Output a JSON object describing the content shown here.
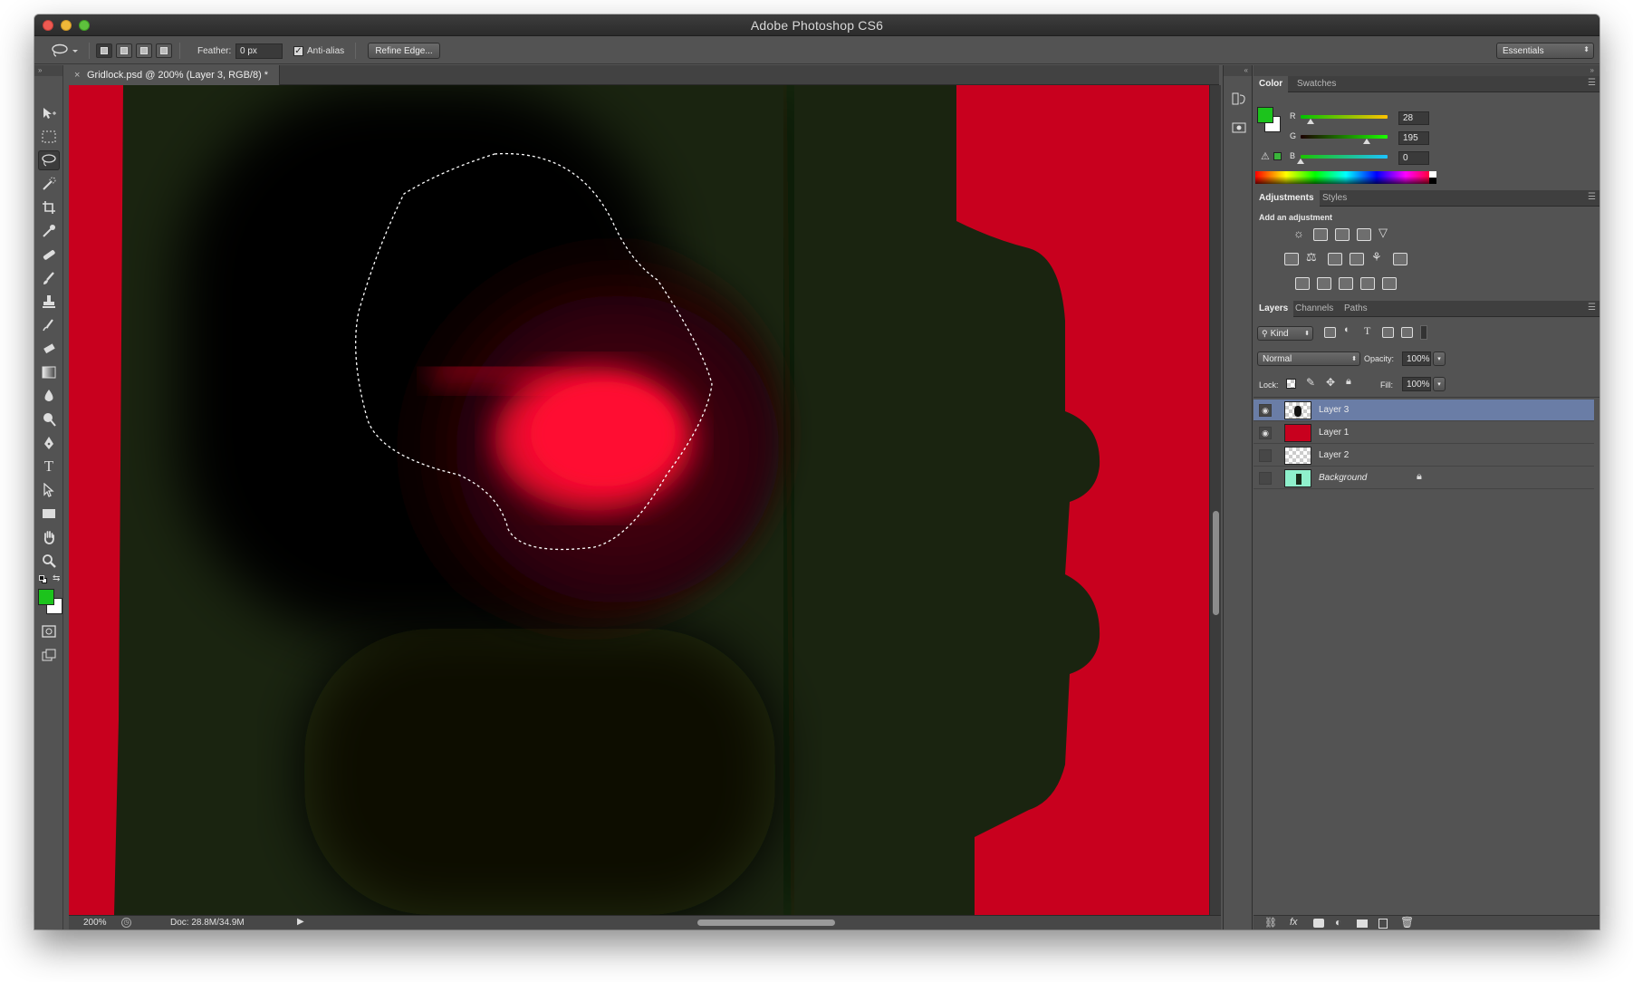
{
  "window": {
    "title": "Adobe Photoshop CS6"
  },
  "options_bar": {
    "feather_label": "Feather:",
    "feather_value": "0 px",
    "antialias_label": "Anti-alias",
    "antialias_checked": true,
    "refine_edge": "Refine Edge...",
    "workspace": "Essentials"
  },
  "document": {
    "tab_title": "Gridlock.psd @ 200% (Layer 3, RGB/8) *",
    "close_glyph": "×"
  },
  "status": {
    "zoom": "200%",
    "doc_size": "Doc: 28.8M/34.9M"
  },
  "tools": [
    "move-tool",
    "rectangular-marquee-tool",
    "lasso-tool",
    "quick-selection-tool",
    "crop-tool",
    "eyedropper-tool",
    "spot-healing-brush-tool",
    "brush-tool",
    "clone-stamp-tool",
    "history-brush-tool",
    "eraser-tool",
    "gradient-tool",
    "blur-tool",
    "dodge-tool",
    "pen-tool",
    "type-tool",
    "path-selection-tool",
    "rectangle-tool",
    "hand-tool",
    "zoom-tool"
  ],
  "colors": {
    "foreground": "#1cc31c",
    "background": "#ffffff",
    "canvas_red": "#c8001e",
    "glow_red": "#ff0a33",
    "dark_green": "#1a2410"
  },
  "color_panel": {
    "tabs": [
      "Color",
      "Swatches"
    ],
    "r_label": "R",
    "g_label": "G",
    "b_label": "B",
    "r": "28",
    "g": "195",
    "b": "0",
    "r_value": 28,
    "g_value": 195,
    "b_value": 0
  },
  "adjustments_panel": {
    "tabs": [
      "Adjustments",
      "Styles"
    ],
    "heading": "Add an adjustment"
  },
  "layers_panel": {
    "tabs": [
      "Layers",
      "Channels",
      "Paths"
    ],
    "filter": "Kind",
    "blend_mode": "Normal",
    "opacity_label": "Opacity:",
    "opacity": "100%",
    "lock_label": "Lock:",
    "fill_label": "Fill:",
    "fill": "100%",
    "layers": [
      {
        "name": "Layer 3",
        "visible": true,
        "selected": true
      },
      {
        "name": "Layer 1",
        "visible": true,
        "selected": false
      },
      {
        "name": "Layer 2",
        "visible": false,
        "selected": false
      },
      {
        "name": "Background",
        "visible": false,
        "selected": false,
        "locked": true
      }
    ],
    "footer_icons": [
      "link-layers-icon",
      "fx-icon",
      "add-mask-icon",
      "adjustment-layer-icon",
      "new-group-icon",
      "new-layer-icon",
      "delete-layer-icon"
    ]
  }
}
